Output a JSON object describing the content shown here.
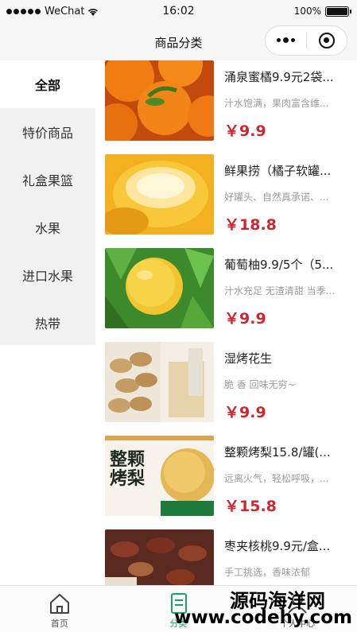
{
  "status_bar": {
    "carrier": "WeChat",
    "time": "16:02",
    "battery": "100%"
  },
  "nav": {
    "title": "商品分类"
  },
  "sidebar": {
    "items": [
      {
        "label": "全部"
      },
      {
        "label": "特价商品"
      },
      {
        "label": "礼盒果篮"
      },
      {
        "label": "水果"
      },
      {
        "label": "进口水果"
      },
      {
        "label": "热带"
      }
    ],
    "active_index": 0
  },
  "products": [
    {
      "name": "涌泉蜜橘9.9元2袋...",
      "desc": "汁水饱满，果肉富含维...",
      "price": "￥9.9"
    },
    {
      "name": "鲜果捞（橘子软罐...",
      "desc": "好罐头、自然真承诺、...",
      "price": "￥18.8"
    },
    {
      "name": "葡萄柚9.9/5个（5...",
      "desc": "汁水充足 无渣清甜 当季...",
      "price": "￥9.9"
    },
    {
      "name": "湿烤花生",
      "desc": "脆 香 回味无穷~",
      "price": "￥9.9"
    },
    {
      "name": "整颗烤梨15.8/罐(...",
      "desc": "远离火气，轻松呼吸，...",
      "price": "￥15.8"
    },
    {
      "name": "枣夹核桃9.9元/盒...",
      "desc": "手工挑选，香味浓郁",
      "price": ""
    }
  ],
  "product_image_text": {
    "pear_line1": "整颗",
    "pear_line2": "烤梨"
  },
  "tab_bar": {
    "tabs": [
      {
        "label": "首页",
        "icon": "home-icon"
      },
      {
        "label": "分类",
        "icon": "category-icon"
      },
      {
        "label": "个人中心",
        "icon": "user-icon"
      }
    ],
    "active_index": 1
  },
  "watermark": {
    "line1": "源码海洋网",
    "line2": "www.codehy.com"
  },
  "colors": {
    "price": "#d0262f",
    "tab_active": "#1aa260",
    "sidebar_bg": "#f1f1f1"
  }
}
